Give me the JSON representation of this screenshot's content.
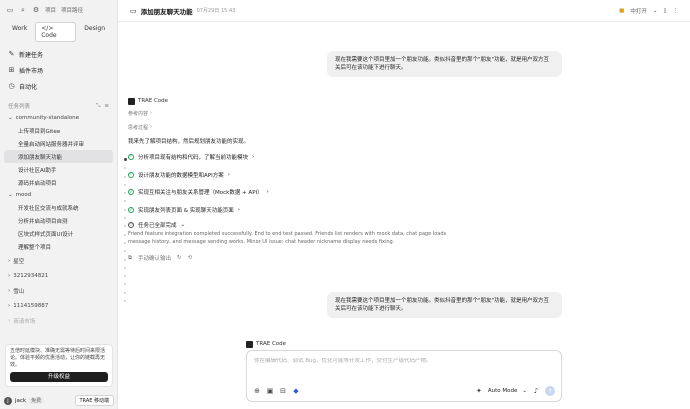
{
  "topbar": {
    "left_label": "项目",
    "path_label": "项目路径"
  },
  "modes": [
    {
      "label": "Work"
    },
    {
      "label": "</> Code"
    },
    {
      "label": "Design"
    }
  ],
  "nav": [
    {
      "label": "新建任务"
    },
    {
      "label": "插件市场"
    },
    {
      "label": "自动化"
    }
  ],
  "tasks_header": "任务列表",
  "groups": [
    {
      "name": "community-standalone",
      "items": [
        "上传项目到Gitee",
        "全量启动网站服务器并评审",
        "添加朋友聊天功能",
        "设计社区AI助手",
        "源码并启动项目"
      ]
    },
    {
      "name": "mood",
      "items": [
        "开发社区交流与成就系统",
        "分析并启动项目自测",
        "区块式样式页面UI设计",
        "理解整个项目"
      ]
    }
  ],
  "collapsed_groups": [
    "星空",
    "3212934821",
    "雪山",
    "1114159887",
    "商请市场"
  ],
  "promo": {
    "text": "五倍时延模块、准确无需等待后时间来限活论。体验平频的优惠活动，让你的链截再无效。",
    "button": "升级权益"
  },
  "user": {
    "name": "jack",
    "plan": "免费",
    "app_button": "TRAE 移动端"
  },
  "header": {
    "title": "添加朋友聊天功能",
    "timestamp": "07月29日 15:43",
    "open_label": "中打开"
  },
  "user_msg_1": "现在我需要这个项目里加一个朋友功能。类似抖音里的那个\"朋友\"功能，就是用户双方互关后可在该功能下进行聊天。",
  "ai": {
    "name": "TRAE Code",
    "ref_toggle": "参考内容",
    "think_toggle": "思考过程",
    "intro": "我来先了解项目结构，然后规划朋友功能的实现。",
    "steps": [
      "分析项目现有结构和代码，了解当前功能模块",
      "设计朋友功能的数据模型和API方案",
      "实现互相关注与朋友关系管理（Mock数据 + API）",
      "实现朋友列表页面 & 实现聊天功能页面",
      "任务已全部完成"
    ],
    "summary": "Friend feature integration completed successfully. End to end test passed. Friends list renders with mock data, chat page loads message history, and message sending works. Minor UI issue: chat header nickname display needs fixing.",
    "manual_label": "手动确认输出"
  },
  "user_msg_2": "现在我需要这个项目里加一个朋友功能。类似抖音里的那个\"朋友\"功能，就是用户双方互关后可在该功能下进行聊天。",
  "ai2_name": "TRAE Code",
  "composer": {
    "placeholder": "你在编辑代码、调试 Bug、优化可能等开发工作，交付生产级代码产物。",
    "mode": "Auto Mode"
  }
}
